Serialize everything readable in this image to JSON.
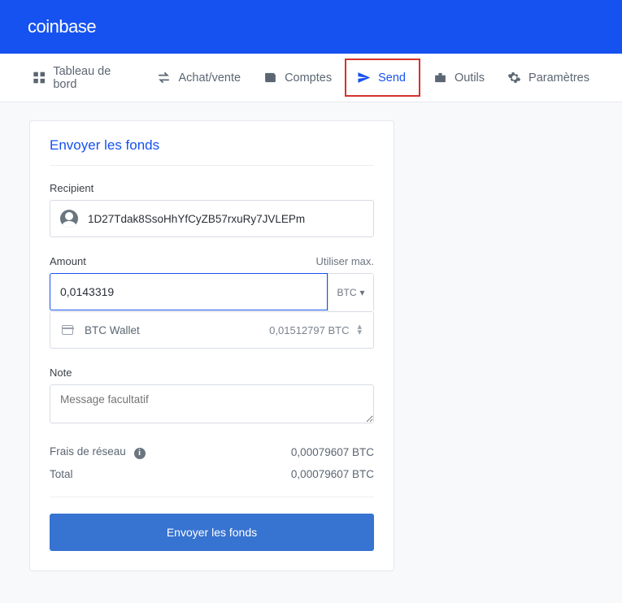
{
  "header": {
    "logo": "coinbase"
  },
  "nav": {
    "dashboard": "Tableau de bord",
    "buy_sell": "Achat/vente",
    "accounts": "Comptes",
    "send": "Send",
    "tools": "Outils",
    "settings": "Paramètres"
  },
  "card": {
    "title": "Envoyer les fonds",
    "recipient_label": "Recipient",
    "recipient_value": "1D27Tdak8SsoHhYfCyZB57rxuRy7JVLEPm",
    "amount_label": "Amount",
    "use_max": "Utiliser max.",
    "amount_value": "0,0143319",
    "currency": "BTC",
    "wallet_name": "BTC Wallet",
    "wallet_balance": "0,01512797 BTC",
    "note_label": "Note",
    "note_placeholder": "Message facultatif",
    "fee_label": "Frais de réseau",
    "fee_value": "0,00079607 BTC",
    "total_label": "Total",
    "total_value": "0,00079607 BTC",
    "submit": "Envoyer les fonds"
  }
}
